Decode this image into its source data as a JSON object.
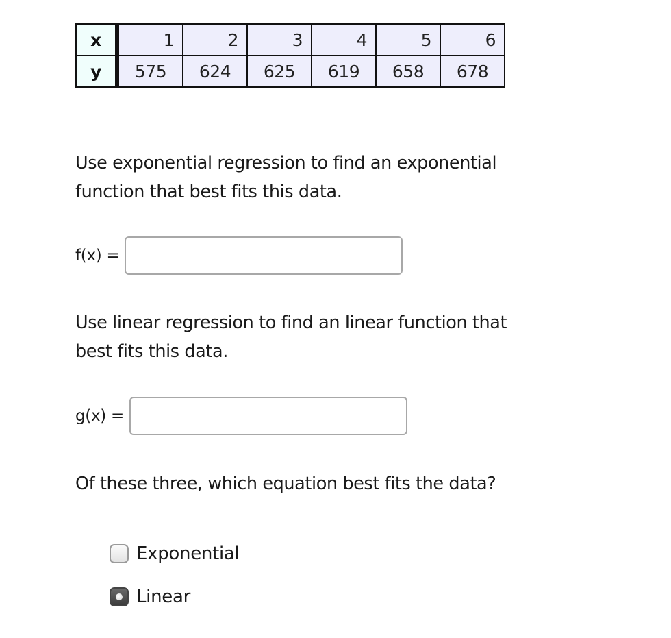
{
  "table": {
    "x_label": "x",
    "y_label": "y",
    "x_values": [
      "1",
      "2",
      "3",
      "4",
      "5",
      "6"
    ],
    "y_values": [
      "575",
      "624",
      "625",
      "619",
      "658",
      "678"
    ]
  },
  "question1": {
    "prompt": "Use exponential regression to find an exponential function that best fits this data.",
    "prompt_line1": "Use exponential regression to find an exponential",
    "prompt_line2": "function that best fits this data.",
    "label": "f(x) =",
    "value": ""
  },
  "question2": {
    "prompt": "Use linear regression to find an linear function that best fits this data.",
    "prompt_line1": "Use linear regression to find an linear function that",
    "prompt_line2": "best fits this data.",
    "label": "g(x) =",
    "value": ""
  },
  "question3": {
    "prompt": "Of these three, which equation best fits the data?",
    "options": [
      {
        "label": "Exponential",
        "selected": false
      },
      {
        "label": "Linear",
        "selected": true
      }
    ]
  },
  "colors": {
    "header_cell_bg": "#f0fefc",
    "data_cell_bg": "#eeeefc",
    "border": "#111111",
    "selected_choice": "#4a4a4a"
  }
}
